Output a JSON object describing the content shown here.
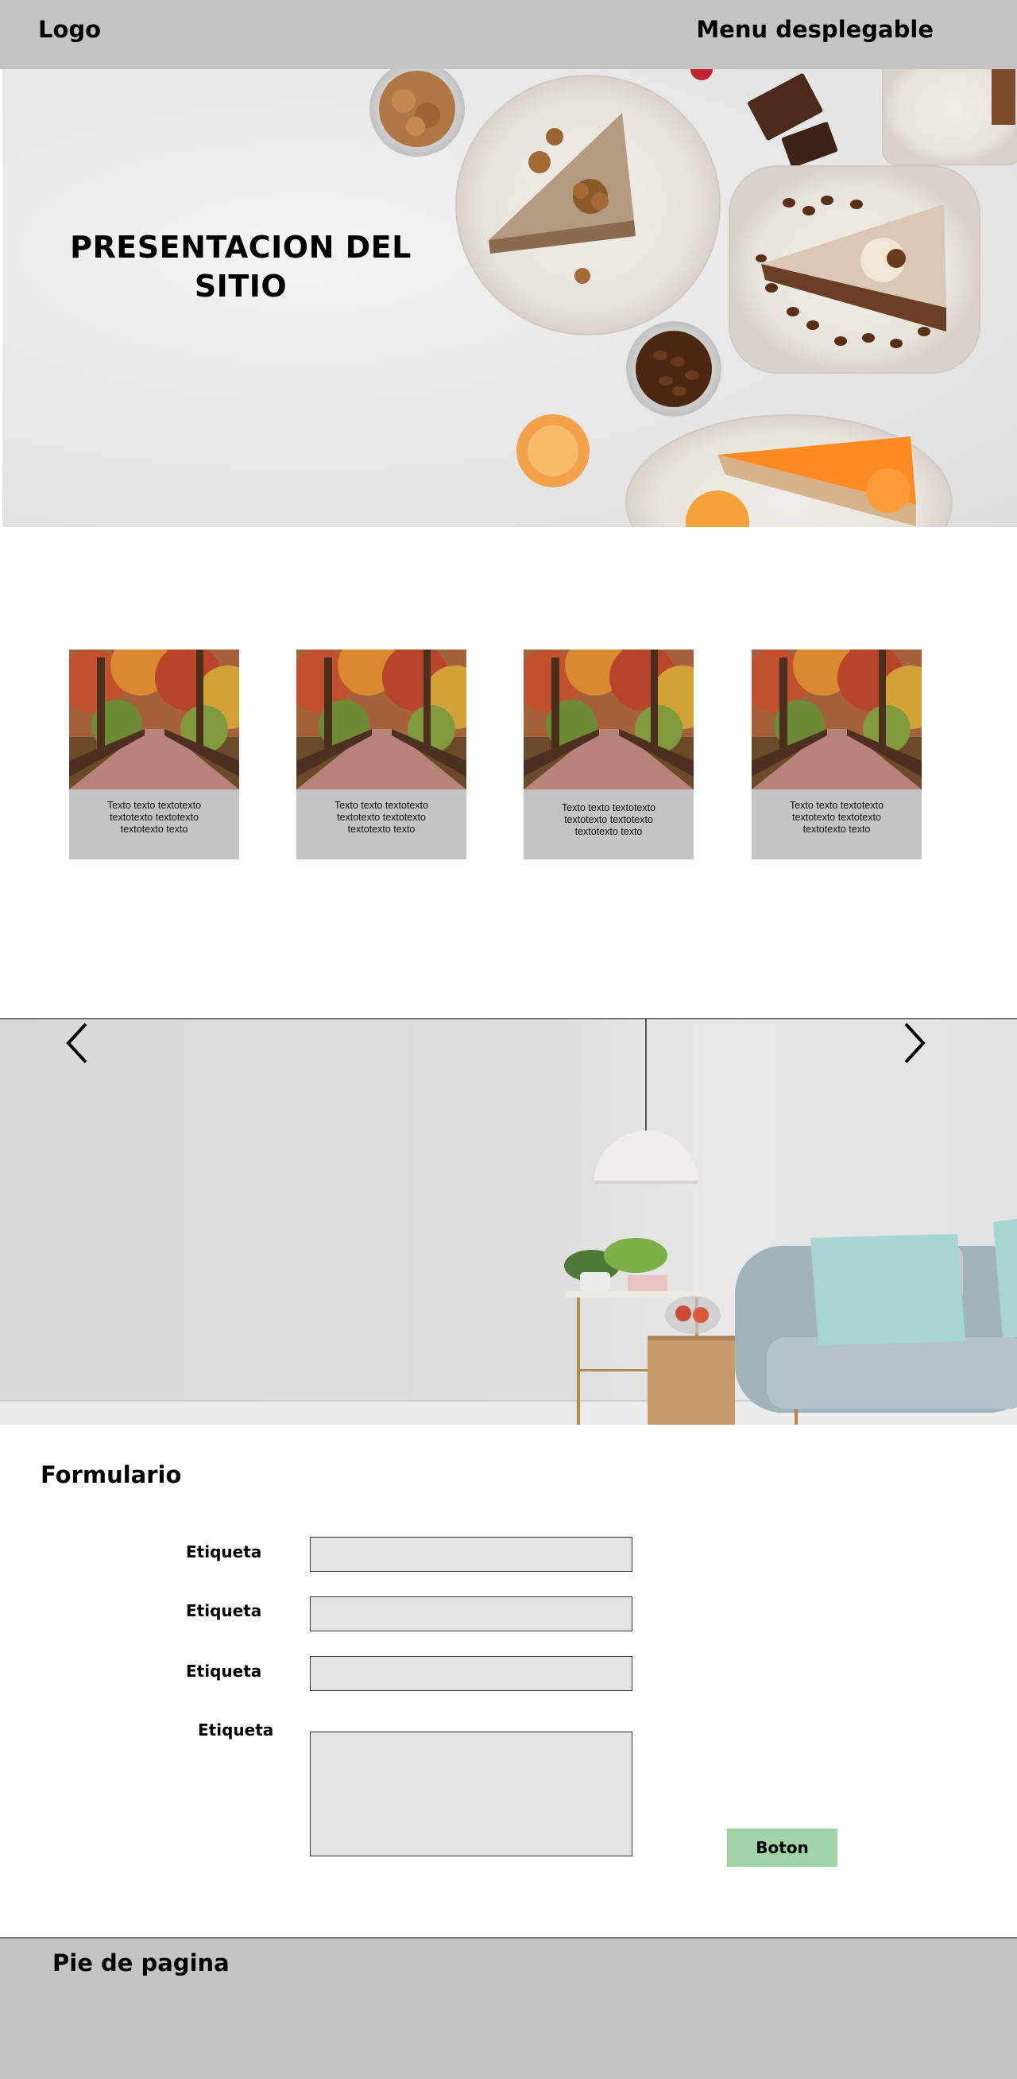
{
  "header": {
    "logo": "Logo",
    "menu_label": "Menu desplegable"
  },
  "hero": {
    "title_line1": "PRESENTACION DEL",
    "title_line2": "SITIO"
  },
  "cards": [
    {
      "text_lines": [
        "Texto texto textotexto",
        "textotexto textotexto",
        "textotexto texto"
      ]
    },
    {
      "text_lines": [
        "Texto texto textotexto",
        "textotexto textotexto",
        "textotexto texto"
      ]
    },
    {
      "text_lines": [
        "Texto texto textotexto",
        "textotexto textotexto",
        "textotexto texto"
      ]
    },
    {
      "text_lines": [
        "Texto texto textotexto",
        "textotexto textotexto",
        "textotexto texto"
      ]
    }
  ],
  "slider": {
    "prev_icon": "chevron-left-icon",
    "next_icon": "chevron-right-icon"
  },
  "form": {
    "title": "Formulario",
    "fields": [
      {
        "label": "Etiqueta",
        "value": ""
      },
      {
        "label": "Etiqueta",
        "value": ""
      },
      {
        "label": "Etiqueta",
        "value": ""
      },
      {
        "label": "Etiqueta",
        "value": ""
      }
    ],
    "button_label": "Boton"
  },
  "footer": {
    "title": "Pie de pagina"
  },
  "colors": {
    "header_bg": "#c4c4c4",
    "footer_bg": "#c4c4c4",
    "card_bg": "#c4c4c4",
    "input_bg": "#e4e4e4",
    "button_bg": "#a0d4a7"
  }
}
